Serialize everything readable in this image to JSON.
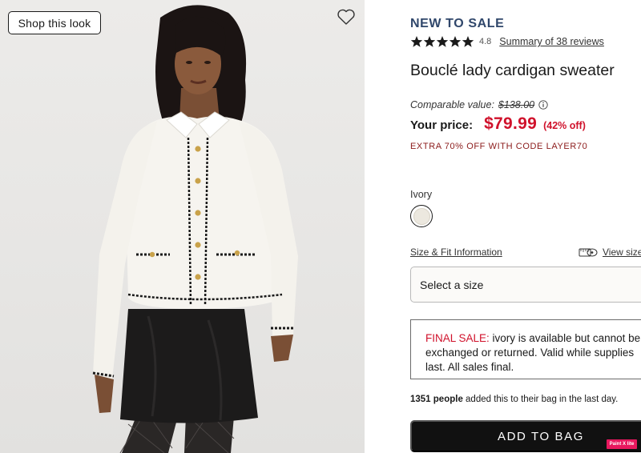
{
  "image_panel": {
    "shop_look_label": "Shop this look",
    "favorite_icon": "heart-outline-icon"
  },
  "product": {
    "badge": "NEW TO SALE",
    "rating": {
      "value": "4.8",
      "stars": 5,
      "reviews_link": "Summary of 38 reviews"
    },
    "title": "Bouclé lady cardigan sweater",
    "comparable_label": "Comparable value:",
    "comparable_price": "$138.00",
    "your_price_label": "Your price:",
    "your_price": "$79.99",
    "percent_off": "(42% off)",
    "promo": "EXTRA 70% OFF WITH CODE LAYER70"
  },
  "color": {
    "label": "Ivory",
    "swatch_color": "#ece8df"
  },
  "size": {
    "fit_link": "Size & Fit Information",
    "view_link": "View size",
    "select_placeholder": "Select a size"
  },
  "final_sale": {
    "label": "FINAL SALE:",
    "line1_rest": " ivory is available but cannot be",
    "line2": "exchanged or returned. Valid while supplies",
    "line3": "last. All sales final."
  },
  "social_proof": {
    "count": "1351 people",
    "text": " added this to their bag in the last day."
  },
  "cta": {
    "add_to_bag": "ADD TO BAG"
  },
  "overlay": {
    "paint_badge": "Paint X lite"
  },
  "colors": {
    "accent_red": "#d0112b",
    "badge_navy": "#30476b",
    "promo_red": "#8b1a1a",
    "button_black": "#111111"
  }
}
